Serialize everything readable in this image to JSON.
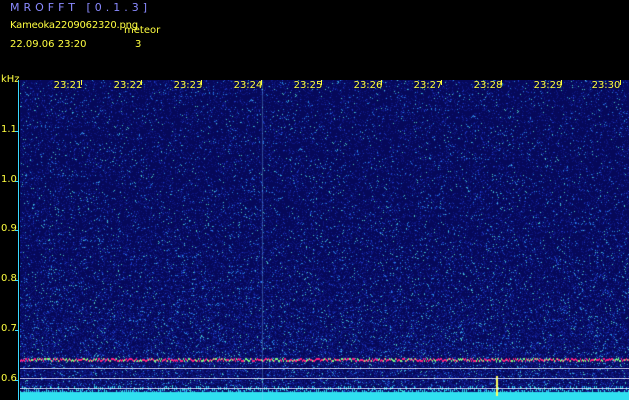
{
  "header": {
    "app_title": "MROFFT [0.1.3]",
    "file_name": "Kameoka2209062320.png",
    "meteor_label": "meteor",
    "datetime": "22.09.06  23:20",
    "meteor_count": "3"
  },
  "axis": {
    "unit_label": "kHz",
    "y_ticks": [
      "1.1",
      "1.0",
      "0.9",
      "0.8",
      "0.7",
      "0.6"
    ],
    "x_ticks": [
      "23:21",
      "23:22",
      "23:23",
      "23:24",
      "23:25",
      "23:26",
      "23:27",
      "23:28",
      "23:29",
      "23:30"
    ]
  },
  "colors": {
    "background": "#06095a",
    "text": "#ffff40",
    "axis": "#3ad8ff",
    "carrier": "#ff2080"
  }
}
